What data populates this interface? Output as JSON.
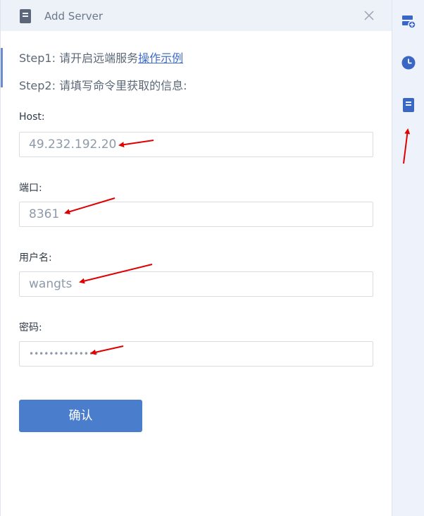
{
  "dialog": {
    "title": "Add Server",
    "step1_text": "Step1: 请开启远端服务",
    "step1_link": "操作示例",
    "step2_text": "Step2: 请填写命令里获取的信息:",
    "host_label": "Host:",
    "host_value": "49.232.192.20",
    "port_label": "端口:",
    "port_value": "8361",
    "username_label": "用户名:",
    "username_value": "wangts",
    "password_label": "密码:",
    "password_value": "••••••••••••••",
    "confirm_label": "确认"
  },
  "sidebar": {
    "icons": [
      "add-server-icon",
      "clock-icon",
      "server-doc-icon"
    ]
  },
  "colors": {
    "accent": "#4a7dcc",
    "annotation": "#e00000"
  }
}
